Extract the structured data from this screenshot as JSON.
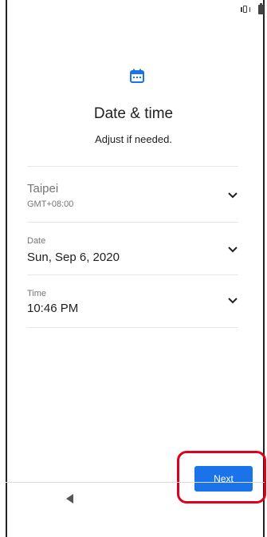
{
  "screen": {
    "title": "Date & time",
    "subtitle": "Adjust if needed."
  },
  "timezone": {
    "city": "Taipei",
    "offset": "GMT+08:00"
  },
  "date": {
    "label": "Date",
    "value": "Sun, Sep 6, 2020"
  },
  "time": {
    "label": "Time",
    "value": "10:46 PM"
  },
  "actions": {
    "next_label": "Next"
  },
  "colors": {
    "accent": "#1a73e8",
    "highlight": "#e0001a"
  },
  "icons": {
    "calendar": "calendar-icon",
    "chevron": "chevron-down-icon",
    "back": "back-triangle-icon",
    "vibrate": "vibrate-icon",
    "battery": "battery-icon"
  }
}
